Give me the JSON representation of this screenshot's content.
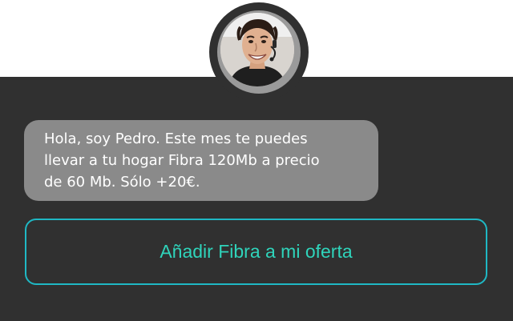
{
  "agent": {
    "avatar_icon": "agent-headset-avatar"
  },
  "message": {
    "lines": [
      "Hola, soy Pedro. Este mes te puedes",
      "llevar a tu hogar Fibra 120Mb a precio",
      "de 60 Mb. Sólo +20€."
    ]
  },
  "cta": {
    "label": "Añadir Fibra a  mi oferta"
  },
  "colors": {
    "panel_background": "#303030",
    "bubble_background": "#8a8a8a",
    "cta_border": "#1fb8c4",
    "cta_text": "#2fd4bb"
  }
}
